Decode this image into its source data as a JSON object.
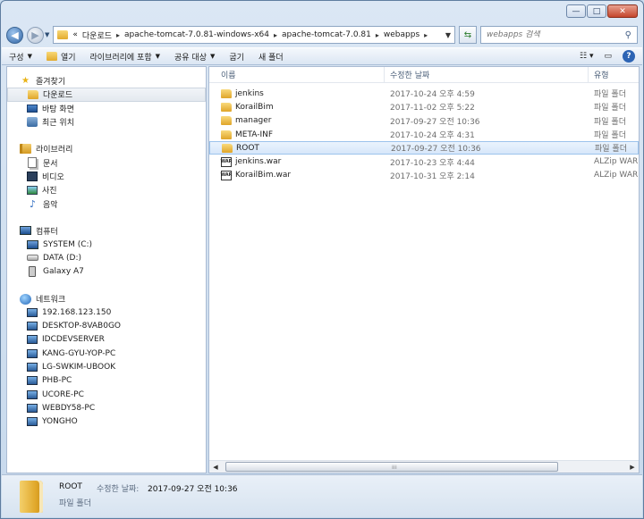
{
  "window": {
    "minimize_label": "—",
    "maximize_label": "□",
    "close_label": "✕"
  },
  "nav": {
    "back_icon": "back-arrow-icon",
    "forward_icon": "forward-arrow-icon",
    "breadcrumb_prefix": "«",
    "breadcrumb": [
      "다운로드",
      "apache-tomcat-7.0.81-windows-x64",
      "apache-tomcat-7.0.81",
      "webapps"
    ],
    "search_placeholder": "webapps 검색"
  },
  "toolbar": {
    "organize": "구성",
    "open": "열기",
    "include_library": "라이브러리에 포함",
    "share": "공유 대상",
    "burn": "굽기",
    "new_folder": "새 폴더"
  },
  "sidebar": {
    "favorites": {
      "label": "즐겨찾기",
      "items": [
        {
          "label": "다운로드",
          "icon": "downloads-folder-icon",
          "selected": true
        },
        {
          "label": "바탕 화면",
          "icon": "desktop-icon"
        },
        {
          "label": "최근 위치",
          "icon": "recent-places-icon"
        }
      ]
    },
    "libraries": {
      "label": "라이브러리",
      "items": [
        {
          "label": "문서",
          "icon": "documents-icon"
        },
        {
          "label": "비디오",
          "icon": "videos-icon"
        },
        {
          "label": "사진",
          "icon": "pictures-icon"
        },
        {
          "label": "음악",
          "icon": "music-icon"
        }
      ]
    },
    "computer": {
      "label": "컴퓨터",
      "items": [
        {
          "label": "SYSTEM (C:)",
          "icon": "system-drive-icon"
        },
        {
          "label": "DATA (D:)",
          "icon": "data-drive-icon"
        },
        {
          "label": "Galaxy A7",
          "icon": "phone-icon"
        }
      ]
    },
    "network": {
      "label": "네트워크",
      "items": [
        {
          "label": "192.168.123.150"
        },
        {
          "label": "DESKTOP-8VAB0GO"
        },
        {
          "label": "IDCDEVSERVER"
        },
        {
          "label": "KANG-GYU-YOP-PC"
        },
        {
          "label": "LG-SWKIM-UBOOK"
        },
        {
          "label": "PHB-PC"
        },
        {
          "label": "UCORE-PC"
        },
        {
          "label": "WEBDY58-PC"
        },
        {
          "label": "YONGHO"
        }
      ]
    }
  },
  "columns": {
    "name": "이름",
    "date": "수정한 날짜",
    "type": "유형"
  },
  "files": [
    {
      "name": "jenkins",
      "date": "2017-10-24 오후 4:59",
      "type": "파일 폴더",
      "kind": "folder"
    },
    {
      "name": "KorailBim",
      "date": "2017-11-02 오후 5:22",
      "type": "파일 폴더",
      "kind": "folder"
    },
    {
      "name": "manager",
      "date": "2017-09-27 오전 10:36",
      "type": "파일 폴더",
      "kind": "folder"
    },
    {
      "name": "META-INF",
      "date": "2017-10-24 오후 4:31",
      "type": "파일 폴더",
      "kind": "folder"
    },
    {
      "name": "ROOT",
      "date": "2017-09-27 오전 10:36",
      "type": "파일 폴더",
      "kind": "folder",
      "selected": true
    },
    {
      "name": "jenkins.war",
      "date": "2017-10-23 오후 4:44",
      "type": "ALZip WAR F",
      "kind": "war"
    },
    {
      "name": "KorailBim.war",
      "date": "2017-10-31 오후 2:14",
      "type": "ALZip WAR F",
      "kind": "war"
    }
  ],
  "details": {
    "name": "ROOT",
    "date_label": "수정한 날짜:",
    "date": "2017-09-27 오전 10:36",
    "type": "파일 폴더"
  }
}
